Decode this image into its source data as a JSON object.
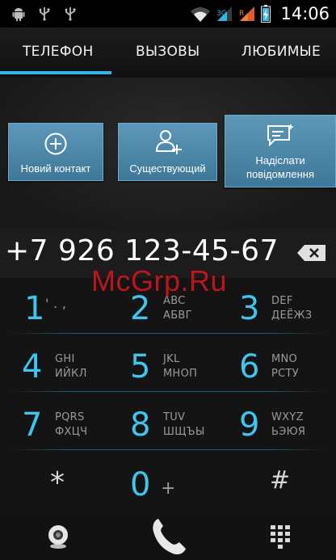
{
  "status_bar": {
    "time": "14:06",
    "icons": [
      "android-icon",
      "usb-icon",
      "usb-icon",
      "wifi-icon",
      "signal-icon",
      "signal-roaming-icon",
      "battery-icon"
    ]
  },
  "tabs": [
    {
      "label": "ТЕЛЕФОН",
      "active": true
    },
    {
      "label": "ВЫЗОВЫ",
      "active": false
    },
    {
      "label": "ЛЮБИМЫЕ",
      "active": false
    }
  ],
  "actions": {
    "new_contact": "Новий контакт",
    "existing": "Существующий",
    "send_message_line1": "Надіслати",
    "send_message_line2": "повідомлення"
  },
  "dialed_number": "+7 926 123-45-67",
  "keypad": [
    {
      "digit": "1",
      "letters": "' . ,",
      "letters2": ""
    },
    {
      "digit": "2",
      "letters": "ABC",
      "letters2": "АБВГ"
    },
    {
      "digit": "3",
      "letters": "DEF",
      "letters2": "ДЕЁЖЗ"
    },
    {
      "digit": "4",
      "letters": "GHI",
      "letters2": "ИЙКЛ"
    },
    {
      "digit": "5",
      "letters": "JKL",
      "letters2": "МНОП"
    },
    {
      "digit": "6",
      "letters": "MNO",
      "letters2": "РСТУ"
    },
    {
      "digit": "7",
      "letters": "PQRS",
      "letters2": "ФХЦЧ"
    },
    {
      "digit": "8",
      "letters": "TUV",
      "letters2": "ШЩЪЫ"
    },
    {
      "digit": "9",
      "letters": "WXYZ",
      "letters2": "ЬЭЮЯ"
    },
    {
      "digit": "*",
      "letters": "",
      "letters2": ""
    },
    {
      "digit": "0",
      "letters": "+",
      "letters2": ""
    },
    {
      "digit": "#",
      "letters": "",
      "letters2": ""
    }
  ],
  "bottom_bar": {
    "icons": [
      "video-call-icon",
      "phone-call-icon",
      "dialpad-icon"
    ]
  },
  "watermark": "McGrp.Ru",
  "colors": {
    "accent": "#33b5e5",
    "digit": "#3fc5ee",
    "button": "#4a86a8",
    "call": "#4caf50"
  }
}
